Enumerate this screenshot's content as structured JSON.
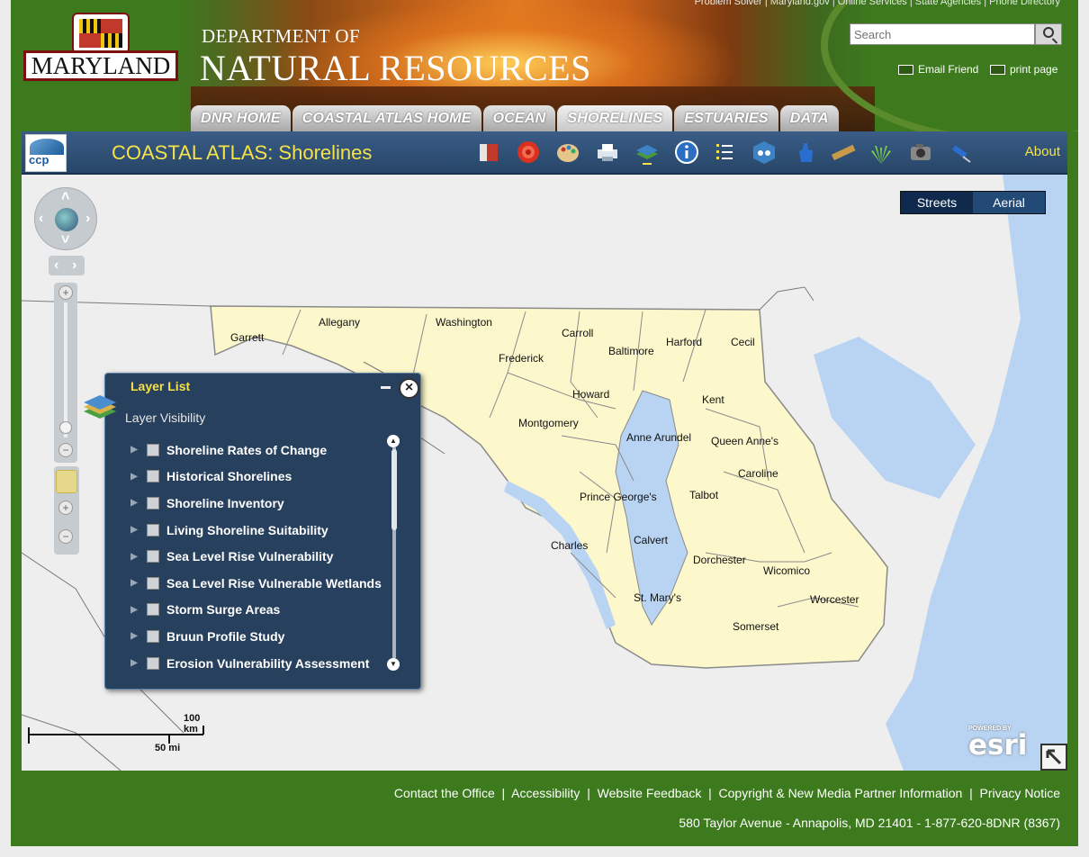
{
  "header": {
    "top_links": "Problem Solver  |  Maryland.gov  |  Online Services  |  State Agencies  |  Phone Directory",
    "logo_text": "MARYLAND",
    "dept_line1": "DEPARTMENT OF",
    "dept_line2": "NATURAL RESOURCES",
    "search_placeholder": "Search",
    "email_friend": "Email Friend",
    "print_page": "print page"
  },
  "tabs": [
    "DNR HOME",
    "COASTAL ATLAS HOME",
    "OCEAN",
    "SHORELINES",
    "ESTUARIES",
    "DATA"
  ],
  "active_tab": "SHORELINES",
  "toolbar": {
    "logo_text": "ccp",
    "title": "COASTAL ATLAS: Shorelines",
    "about": "About",
    "tools": [
      "book-icon",
      "target-icon",
      "palette-icon",
      "print-icon",
      "layers-icon",
      "info-icon",
      "list-icon",
      "cube-tool-icon",
      "hand-pointer-icon",
      "ruler-icon",
      "grass-icon",
      "camera-icon",
      "pin-icon"
    ]
  },
  "map": {
    "basemap": {
      "streets": "Streets",
      "aerial": "Aerial",
      "selected": "Streets"
    },
    "counties": [
      "Garrett",
      "Allegany",
      "Washington",
      "Carroll",
      "Frederick",
      "Baltimore",
      "Harford",
      "Cecil",
      "Howard",
      "Kent",
      "Montgomery",
      "Anne Arundel",
      "Queen Anne's",
      "Caroline",
      "Prince George's",
      "Talbot",
      "Charles",
      "Calvert",
      "Dorchester",
      "Wicomico",
      "St. Mary's",
      "Worcester",
      "Somerset"
    ],
    "colors": {
      "land": "#fdf8cc",
      "water": "#b8d4f2",
      "background": "#eeeeee",
      "border": "#8a8a8a"
    }
  },
  "layer_list": {
    "title": "Layer List",
    "subtitle": "Layer Visibility",
    "layers": [
      "Shoreline Rates of Change",
      "Historical Shorelines",
      "Shoreline Inventory",
      "Living Shoreline Suitability",
      "Sea Level Rise Vulnerability",
      "Sea Level Rise Vulnerable Wetlands",
      "Storm Surge Areas",
      "Bruun Profile Study",
      "Erosion Vulnerability Assessment"
    ]
  },
  "scale": {
    "km": "100 km",
    "mi": "50 mi"
  },
  "esri": {
    "powered_by": "POWERED BY",
    "logo": "esri"
  },
  "footer": {
    "links": [
      "Contact the Office",
      "Accessibility",
      "Website Feedback",
      "Copyright & New Media Partner Information",
      "Privacy Notice"
    ],
    "address": "580 Taylor Avenue - Annapolis, MD 21401 - 1-877-620-8DNR (8367)"
  }
}
